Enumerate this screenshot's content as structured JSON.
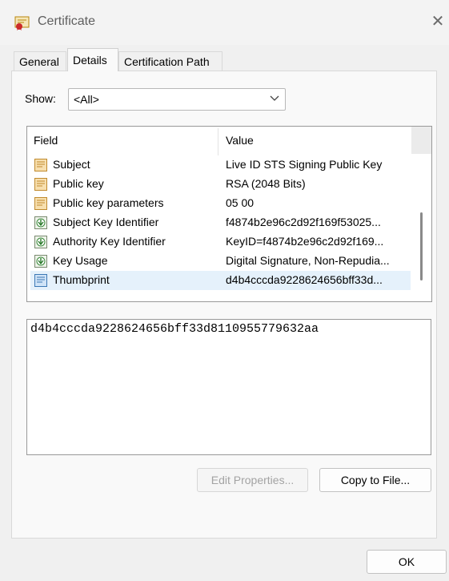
{
  "window": {
    "title": "Certificate",
    "close_icon": "close-icon"
  },
  "tabs": [
    {
      "label": "General"
    },
    {
      "label": "Details",
      "active": true
    },
    {
      "label": "Certification Path"
    }
  ],
  "show": {
    "label": "Show:",
    "value": "<All>"
  },
  "list": {
    "columns": {
      "field": "Field",
      "value": "Value"
    },
    "rows": [
      {
        "icon": "certificate-field-icon",
        "field": "Subject",
        "value": "Live ID STS Signing Public Key"
      },
      {
        "icon": "certificate-field-icon",
        "field": "Public key",
        "value": "RSA (2048 Bits)"
      },
      {
        "icon": "certificate-field-icon",
        "field": "Public key parameters",
        "value": "05 00"
      },
      {
        "icon": "extension-field-icon",
        "field": "Subject Key Identifier",
        "value": "f4874b2e96c2d92f169f53025..."
      },
      {
        "icon": "extension-field-icon",
        "field": "Authority Key Identifier",
        "value": "KeyID=f4874b2e96c2d92f169..."
      },
      {
        "icon": "extension-field-icon",
        "field": "Key Usage",
        "value": "Digital Signature, Non-Repudia..."
      },
      {
        "icon": "property-field-icon",
        "field": "Thumbprint",
        "value": "d4b4cccda9228624656bff33d...",
        "selected": true
      }
    ]
  },
  "detail": {
    "text": "d4b4cccda9228624656bff33d8110955779632aa"
  },
  "buttons": {
    "edit": "Edit Properties...",
    "copy": "Copy to File...",
    "ok": "OK"
  },
  "colors": {
    "selection": "#e5f1fb",
    "background": "#f0f0f0"
  }
}
